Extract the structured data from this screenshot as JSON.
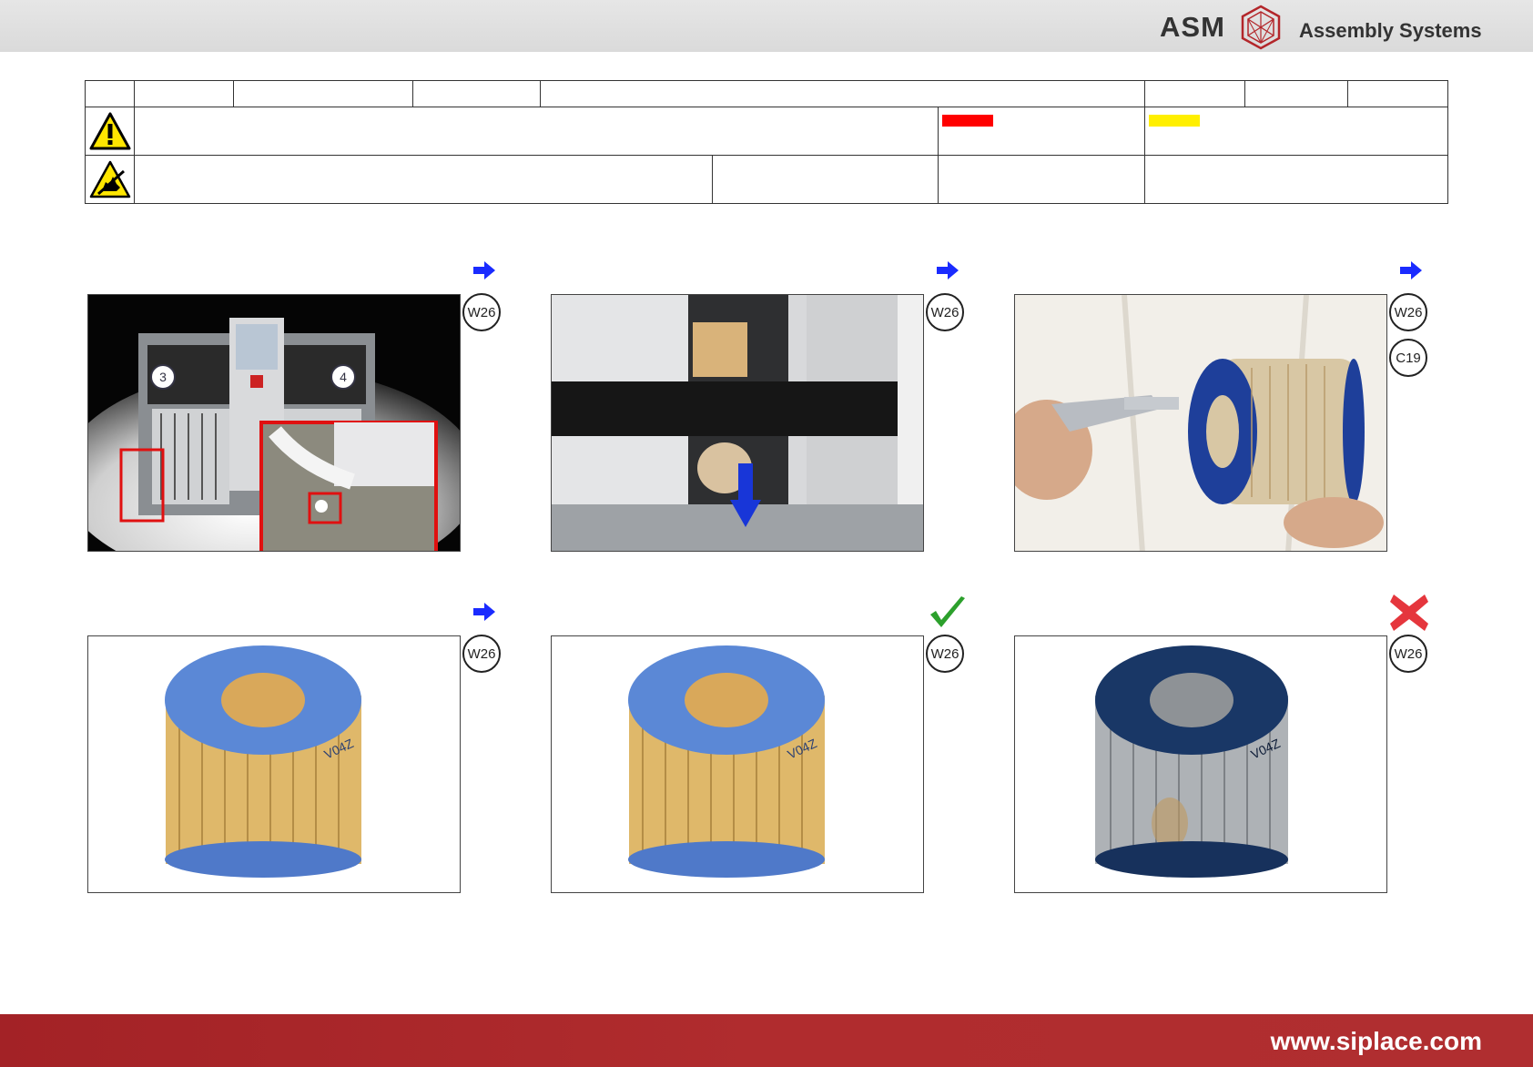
{
  "header": {
    "logo_text": "ASM",
    "logo_tagline": "Assembly Systems",
    "logo_icon": "asm-hexagon-logo-icon"
  },
  "meta_table": {
    "warning_icon": "warning-triangle-icon",
    "esd_icon": "esd-hand-icon",
    "colors": {
      "red": "#ff0000",
      "yellow": "#ffef00"
    }
  },
  "panels": [
    {
      "marker": "blue-arrow-icon",
      "badges": [
        "W26"
      ],
      "image": "machine-with-filter-location"
    },
    {
      "marker": "blue-arrow-icon",
      "badges": [
        "W26"
      ],
      "image": "filter-removal-downward"
    },
    {
      "marker": "blue-arrow-icon",
      "badges": [
        "W26",
        "C19"
      ],
      "image": "air-gun-cleaning-filter"
    },
    {
      "marker": "blue-arrow-icon",
      "badges": [
        "W26"
      ],
      "image": "filter-clean"
    },
    {
      "marker": "green-check-icon",
      "badges": [
        "W26"
      ],
      "image": "filter-clean-ok"
    },
    {
      "marker": "red-cross-icon",
      "badges": [
        "W26"
      ],
      "image": "filter-dirty-not-ok"
    }
  ],
  "footer": {
    "url": "www.siplace.com",
    "color": "#a32226"
  }
}
